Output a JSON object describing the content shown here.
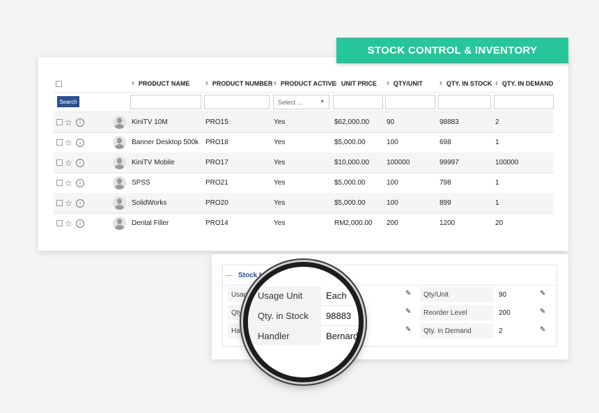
{
  "banner": {
    "title": "STOCK CONTROL & INVENTORY"
  },
  "table": {
    "columns": [
      "PRODUCT NAME",
      "PRODUCT NUMBER",
      "PRODUCT ACTIVE",
      "UNIT PRICE",
      "QTY/UNIT",
      "QTY. IN STOCK",
      "QTY. IN DEMAND"
    ],
    "search_label": "Search",
    "select_placeholder": "Select ...",
    "rows": [
      {
        "name": "KiniTV 10M",
        "number": "PRO15",
        "active": "Yes",
        "price": "$62,000.00",
        "qty_unit": "90",
        "in_stock": "98883",
        "in_demand": "2"
      },
      {
        "name": "Banner Desktop 500k",
        "number": "PRO18",
        "active": "Yes",
        "price": "$5,000.00",
        "qty_unit": "100",
        "in_stock": "698",
        "in_demand": "1"
      },
      {
        "name": "KiniTV Mobile",
        "number": "PRO17",
        "active": "Yes",
        "price": "$10,000.00",
        "qty_unit": "100000",
        "in_stock": "99997",
        "in_demand": "100000"
      },
      {
        "name": "SPSS",
        "number": "PRO21",
        "active": "Yes",
        "price": "$5,000.00",
        "qty_unit": "100",
        "in_stock": "798",
        "in_demand": "1"
      },
      {
        "name": "SolidWorks",
        "number": "PRO20",
        "active": "Yes",
        "price": "$5,000.00",
        "qty_unit": "100",
        "in_stock": "899",
        "in_demand": "1"
      },
      {
        "name": "Dental Filler",
        "number": "PRO14",
        "active": "Yes",
        "price": "RM2,000.00",
        "qty_unit": "200",
        "in_stock": "1200",
        "in_demand": "20"
      }
    ]
  },
  "stock_info": {
    "title": "Stock Info",
    "left": [
      {
        "label": "Usage",
        "value": ""
      },
      {
        "label": "Qty.",
        "value": ""
      },
      {
        "label": "Han",
        "value": ""
      }
    ],
    "right": [
      {
        "label": "Qty/Unit",
        "value": "90"
      },
      {
        "label": "Reorder Level",
        "value": "200"
      },
      {
        "label": "Qty. in Demand",
        "value": "2"
      }
    ]
  },
  "magnifier": {
    "rows": [
      {
        "label": "Usage Unit",
        "value": "Each"
      },
      {
        "label": "Qty. in Stock",
        "value": "98883"
      },
      {
        "label": "Handler",
        "value": "Bernardo Egeoa"
      }
    ]
  },
  "colors": {
    "banner": "#27c59a",
    "search_button": "#2b4f91",
    "section_title": "#2b4f91"
  }
}
